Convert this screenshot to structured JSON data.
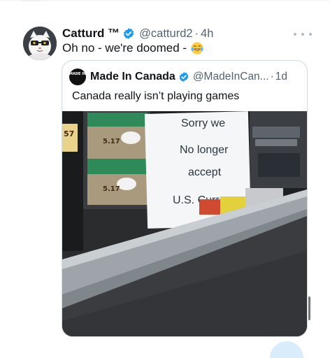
{
  "tweet": {
    "display_name": "Catturd ™",
    "handle": "@catturd2",
    "separator": "·",
    "time": "4h",
    "text": "Oh no - we're doomed -",
    "emoji": "laughing-with-tears-emoji"
  },
  "quoted_tweet": {
    "avatar_text": "MADE IN",
    "display_name": "Made In Canada",
    "handle": "@MadeInCan...",
    "separator": "·",
    "time": "1d",
    "text": "Canada really isn’t playing games",
    "media": {
      "sign_lines": [
        "Sorry we",
        "No longer",
        "accept",
        "U.S. Currency"
      ],
      "price_tag_top": "5.17",
      "price_tag_bottom": "5.17",
      "left_edge_tag": "57"
    }
  },
  "icons": {
    "verified": "verified-badge-icon",
    "more": "more-options-icon"
  },
  "colors": {
    "verified_blue": "#1d9bf0",
    "secondary_text": "#536471",
    "border": "#cfd9de"
  }
}
